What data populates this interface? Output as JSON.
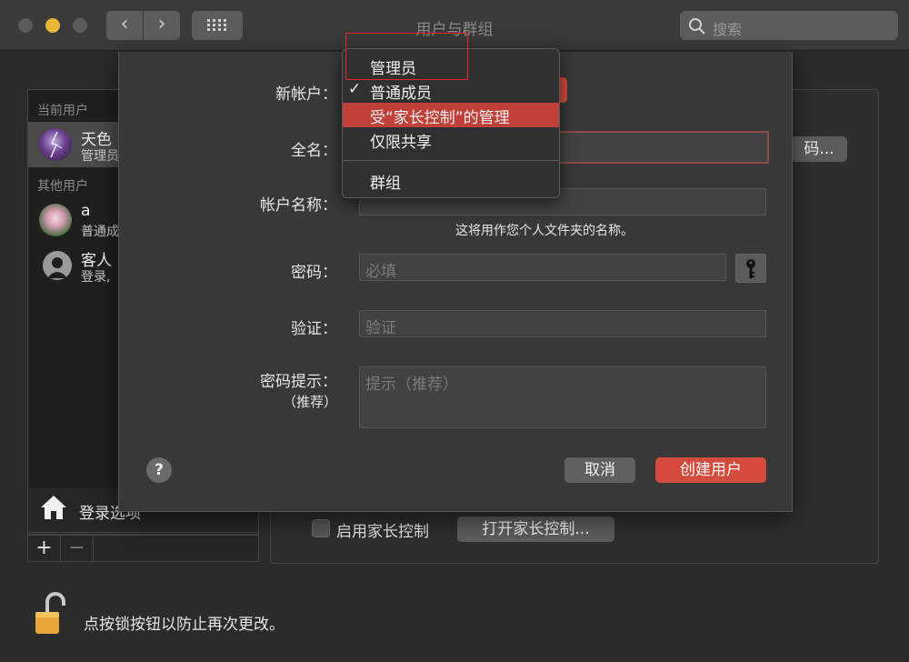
{
  "window": {
    "title": "用户与群组",
    "search_placeholder": "搜索",
    "nav": {
      "back": "‹",
      "forward": "›"
    }
  },
  "sidebar": {
    "current_header": "当前用户",
    "other_header": "其他用户",
    "users": [
      {
        "name": "天色",
        "role": "管理员"
      },
      {
        "name": "a",
        "role": "普通成员"
      },
      {
        "name": "客人",
        "role": "登录,"
      }
    ],
    "login_options": "登录选项",
    "add": "+",
    "remove": "−"
  },
  "background": {
    "change_password": "码...",
    "enable_parental": "启用家长控制",
    "open_parental": "打开家长控制...",
    "lock_text": "点按锁按钮以防止再次更改。"
  },
  "sheet": {
    "new_account_label": "新帐户：",
    "full_name_label": "全名：",
    "account_name_label": "帐户名称：",
    "account_name_hint": "这将用作您个人文件夹的名称。",
    "password_label": "密码：",
    "password_placeholder": "必填",
    "verify_label": "验证：",
    "verify_placeholder": "验证",
    "hint_label": "密码提示：",
    "hint_label_sub": "（推荐）",
    "hint_placeholder": "提示（推荐）",
    "help": "?",
    "cancel": "取消",
    "create": "创建用户"
  },
  "menu": {
    "items": [
      {
        "label": "管理员",
        "checked": false,
        "highlighted": false
      },
      {
        "label": "普通成员",
        "checked": true,
        "highlighted": false
      },
      {
        "label": "受“家长控制”的管理",
        "checked": false,
        "highlighted": true
      },
      {
        "label": "仅限共享",
        "checked": false,
        "highlighted": false
      }
    ],
    "group_item": "群组",
    "check_mark": "✓"
  },
  "colors": {
    "accent": "#d44a3c",
    "highlight": "#c0403a",
    "annotation": "#e02828"
  }
}
